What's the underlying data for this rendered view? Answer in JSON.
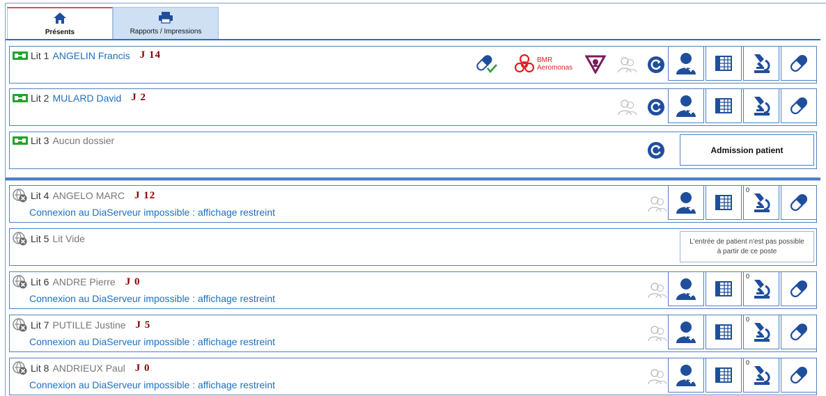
{
  "tabs": [
    {
      "label": "Présents",
      "icon": "home-icon",
      "active": true
    },
    {
      "label": "Rapports / Impressions",
      "icon": "printer-icon",
      "active": false
    }
  ],
  "colors": {
    "accent": "#1f4e9c",
    "link": "#1f6fbf",
    "day": "#8b0000",
    "alert": "#e02020",
    "bed": "#22a52a"
  },
  "beds": [
    {
      "bed": "Lit 1",
      "name": "ANGELIN Francis",
      "day": "J 14",
      "bmr": {
        "line1": "BMR",
        "line2": "Aeromonas"
      }
    },
    {
      "bed": "Lit 2",
      "name": "MULARD David",
      "day": "J 2"
    },
    {
      "bed": "Lit 3",
      "name": "Aucun dossier",
      "button": "Admission patient"
    },
    {
      "bed": "Lit 4",
      "name": "ANGELO MARC",
      "day": "J 12",
      "warning": "Connexion au DiaServeur impossible : affichage restreint",
      "badge": "0"
    },
    {
      "bed": "Lit 5",
      "name": "Lit Vide",
      "info": "L'entrée de patient n'est pas possible à partir de ce poste"
    },
    {
      "bed": "Lit 6",
      "name": "ANDRE Pierre",
      "day": "J 0",
      "warning": "Connexion au DiaServeur impossible : affichage restreint",
      "badge": "0"
    },
    {
      "bed": "Lit 7",
      "name": "PUTILLE Justine",
      "day": "J 5",
      "warning": "Connexion au DiaServeur impossible : affichage restreint",
      "badge": "0"
    },
    {
      "bed": "Lit 8",
      "name": "ANDRIEUX Paul",
      "day": "J 0",
      "warning": "Connexion au DiaServeur impossible : affichage restreint",
      "badge": "0"
    }
  ]
}
